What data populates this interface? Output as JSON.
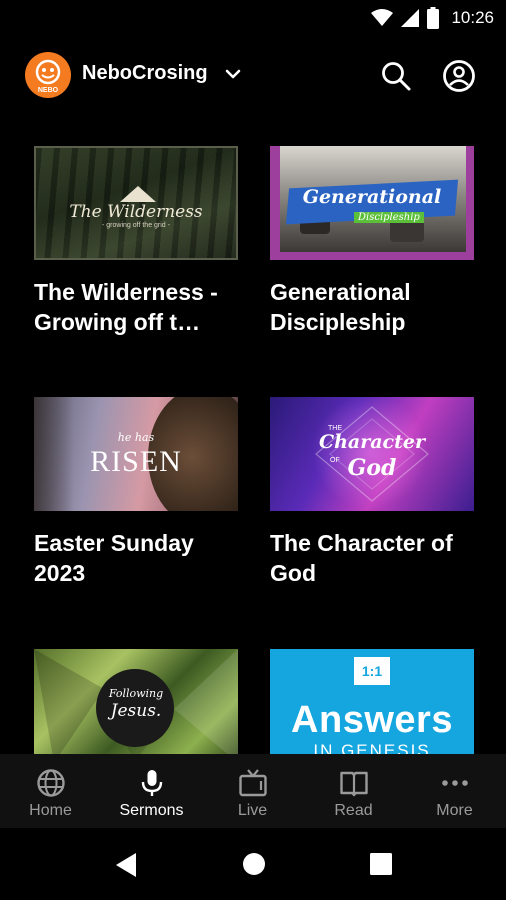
{
  "status_bar": {
    "time": "10:26"
  },
  "header": {
    "church_name": "NeboCrosing",
    "logo_text": "NEBO"
  },
  "sermons": [
    {
      "title": "The Wilderness - Growing off t…",
      "thumb_title": "The Wilderness",
      "thumb_subtitle": "- growing off the grid -"
    },
    {
      "title": "Generational Discipleship",
      "thumb_title": "Generational",
      "thumb_subtitle": "Discipleship"
    },
    {
      "title": "Easter Sunday 2023",
      "thumb_kicker": "he has",
      "thumb_title": "RISEN"
    },
    {
      "title": "The Character of God",
      "thumb_kicker": "THE",
      "thumb_title": "Character",
      "thumb_of": "OF",
      "thumb_subtitle": "God"
    },
    {
      "title": "",
      "thumb_title": "Following",
      "thumb_subtitle": "Jesus."
    },
    {
      "title": "",
      "thumb_badge": "1:1",
      "thumb_title": "Answers",
      "thumb_subtitle": "IN GENESIS"
    }
  ],
  "bottom_nav": [
    {
      "label": "Home",
      "icon": "globe-icon",
      "active": false
    },
    {
      "label": "Sermons",
      "icon": "microphone-icon",
      "active": true
    },
    {
      "label": "Live",
      "icon": "tv-icon",
      "active": false
    },
    {
      "label": "Read",
      "icon": "book-icon",
      "active": false
    },
    {
      "label": "More",
      "icon": "more-icon",
      "active": false
    }
  ],
  "colors": {
    "accent": "#f47b20",
    "background": "#000000",
    "nav_background": "#111111",
    "inactive": "#9a9a9a"
  }
}
